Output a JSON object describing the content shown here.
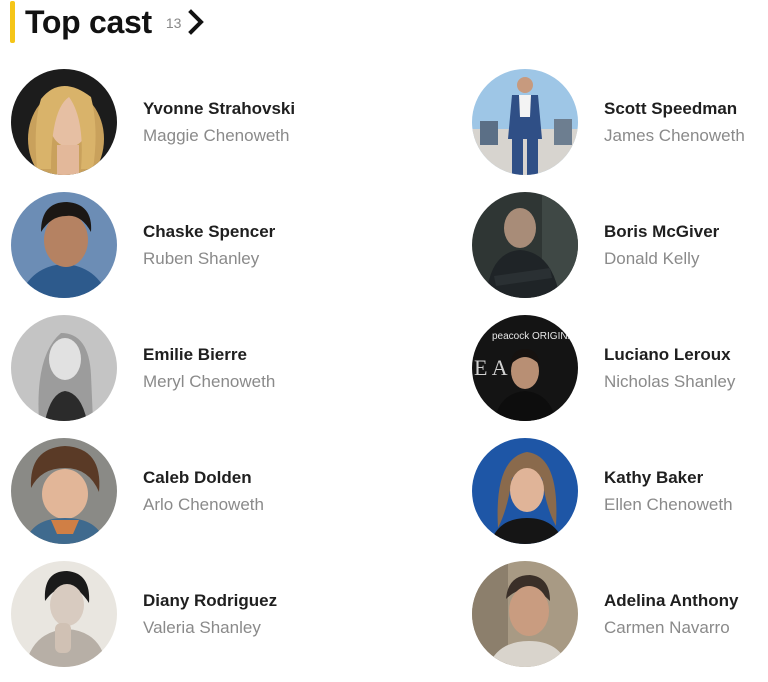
{
  "header": {
    "title": "Top cast",
    "count": "13",
    "accent_color": "#f5c518",
    "icon": "chevron-right-icon"
  },
  "cast": [
    {
      "actor": "Yvonne Strahovski",
      "character": "Maggie Chenoweth"
    },
    {
      "actor": "Scott Speedman",
      "character": "James Chenoweth"
    },
    {
      "actor": "Chaske Spencer",
      "character": "Ruben Shanley"
    },
    {
      "actor": "Boris McGiver",
      "character": "Donald Kelly"
    },
    {
      "actor": "Emilie Bierre",
      "character": "Meryl Chenoweth"
    },
    {
      "actor": "Luciano Leroux",
      "character": "Nicholas Shanley"
    },
    {
      "actor": "Caleb Dolden",
      "character": "Arlo Chenoweth"
    },
    {
      "actor": "Kathy Baker",
      "character": "Ellen Chenoweth"
    },
    {
      "actor": "Diany Rodriguez",
      "character": "Valeria Shanley"
    },
    {
      "actor": "Adelina Anthony",
      "character": "Carmen Navarro"
    }
  ],
  "photo_overlay_text": {
    "luciano": "peacock ORIGINAL"
  }
}
